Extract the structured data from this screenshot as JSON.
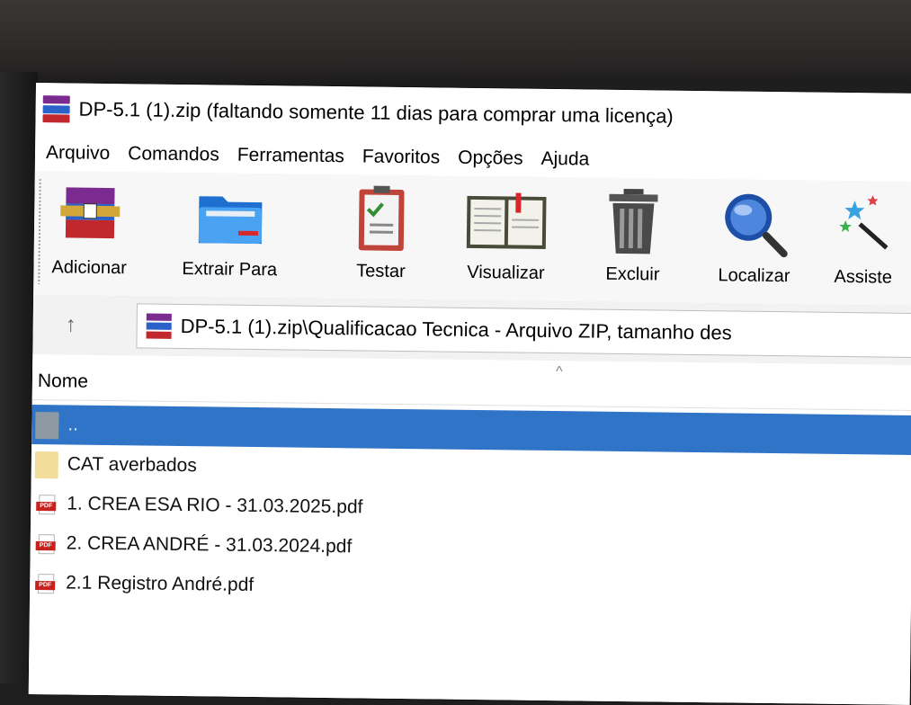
{
  "window": {
    "title": "DP-5.1 (1).zip (faltando somente 11 dias para comprar uma licença)"
  },
  "menu": [
    "Arquivo",
    "Comandos",
    "Ferramentas",
    "Favoritos",
    "Opções",
    "Ajuda"
  ],
  "toolbar": [
    {
      "label": "Adicionar",
      "icon": "add-archive-icon"
    },
    {
      "label": "Extrair Para",
      "icon": "extract-folder-icon"
    },
    {
      "label": "Testar",
      "icon": "test-clipboard-icon"
    },
    {
      "label": "Visualizar",
      "icon": "view-book-icon"
    },
    {
      "label": "Excluir",
      "icon": "trash-icon"
    },
    {
      "label": "Localizar",
      "icon": "magnifier-icon"
    },
    {
      "label": "Assiste",
      "icon": "wizard-wand-icon"
    }
  ],
  "address": {
    "up_arrow": "↑",
    "path": "DP-5.1 (1).zip\\Qualificacao Tecnica - Arquivo ZIP, tamanho des"
  },
  "list": {
    "column_name": "Nome",
    "sort_indicator": "^",
    "rows": [
      {
        "name": "..",
        "icon": "parent-folder-icon",
        "selected": true
      },
      {
        "name": "CAT averbados",
        "icon": "folder-icon",
        "selected": false
      },
      {
        "name": "1. CREA ESA RIO - 31.03.2025.pdf",
        "icon": "pdf-icon",
        "selected": false
      },
      {
        "name": "2. CREA ANDRÉ - 31.03.2024.pdf",
        "icon": "pdf-icon",
        "selected": false
      },
      {
        "name": "2.1 Registro André.pdf",
        "icon": "pdf-icon",
        "selected": false
      }
    ]
  },
  "colors": {
    "selection": "#2f74c7",
    "pdf_red": "#c8211c",
    "folder_yellow": "#f2dd9a"
  },
  "pdf_badge": "PDF"
}
